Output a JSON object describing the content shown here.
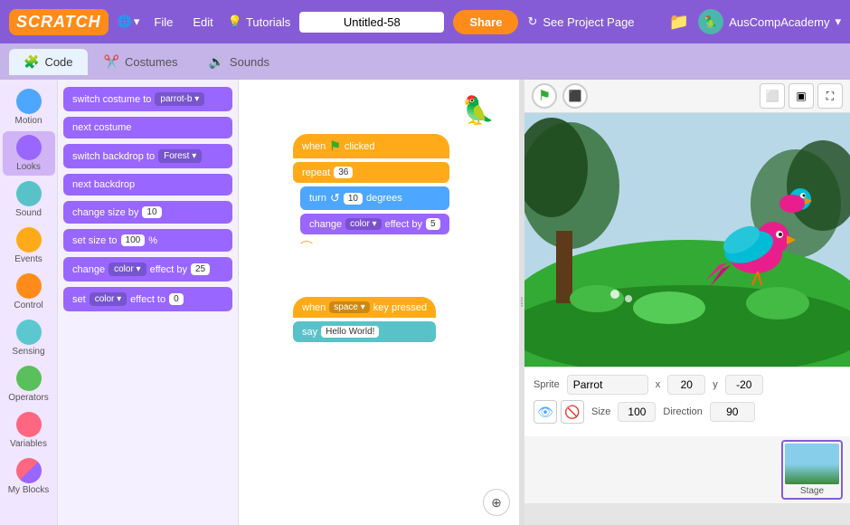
{
  "app": {
    "title": "Scratch",
    "logo": "SCRATCH"
  },
  "topnav": {
    "globe_label": "🌐",
    "file_label": "File",
    "edit_label": "Edit",
    "tutorials_label": "Tutorials",
    "tutorials_icon": "💡",
    "project_title": "Untitled-58",
    "share_label": "Share",
    "see_project_label": "See Project Page",
    "folder_icon": "📁",
    "user_name": "AusCompAcademy",
    "chevron": "▾"
  },
  "tabs": {
    "code_label": "Code",
    "costumes_label": "Costumes",
    "sounds_label": "Sounds"
  },
  "sidebar": {
    "items": [
      {
        "id": "motion",
        "label": "Motion",
        "color": "#4da6ff"
      },
      {
        "id": "looks",
        "label": "Looks",
        "color": "#9966ff"
      },
      {
        "id": "sound",
        "label": "Sound",
        "color": "#59c2c9"
      },
      {
        "id": "events",
        "label": "Events",
        "color": "#ffab19"
      },
      {
        "id": "control",
        "label": "Control",
        "color": "#ff8c1a"
      },
      {
        "id": "sensing",
        "label": "Sensing",
        "color": "#59c2c9"
      },
      {
        "id": "operators",
        "label": "Operators",
        "color": "#59c05b"
      },
      {
        "id": "variables",
        "label": "Variables",
        "color": "#ff6680"
      },
      {
        "id": "myblocks",
        "label": "My Blocks",
        "color": "#ff0066"
      }
    ]
  },
  "blocks_panel": {
    "blocks": [
      {
        "text": "switch costume to",
        "dropdown": "parrot-b",
        "color": "purple"
      },
      {
        "text": "next costume",
        "color": "purple"
      },
      {
        "text": "switch backdrop to",
        "dropdown": "Forest",
        "color": "purple"
      },
      {
        "text": "next backdrop",
        "color": "purple"
      },
      {
        "text": "change size by",
        "value": "10",
        "color": "purple"
      },
      {
        "text": "set size to",
        "value": "100",
        "suffix": "%",
        "color": "purple"
      },
      {
        "text": "change",
        "dropdown": "color",
        "suffix": "effect by",
        "value": "25",
        "color": "purple"
      },
      {
        "text": "set",
        "dropdown": "color",
        "suffix": "effect to",
        "value": "0",
        "color": "purple"
      }
    ]
  },
  "scripts": {
    "script1": {
      "blocks": [
        {
          "type": "hat",
          "text": "when",
          "flag": true,
          "suffix": "clicked"
        },
        {
          "type": "orange",
          "text": "repeat",
          "value": "36"
        },
        {
          "type": "blue",
          "text": "turn",
          "icon": "↺",
          "value": "10",
          "suffix": "degrees"
        },
        {
          "type": "purple",
          "text": "change",
          "dropdown": "color",
          "suffix": "effect by",
          "value": "5"
        }
      ]
    },
    "script2": {
      "blocks": [
        {
          "type": "hat2",
          "text": "when",
          "dropdown": "space",
          "suffix": "key pressed"
        },
        {
          "type": "teal",
          "text": "say",
          "value": "Hello World!"
        }
      ]
    }
  },
  "stage": {
    "green_flag_tooltip": "Green Flag",
    "stop_tooltip": "Stop",
    "sprite_label": "Sprite",
    "sprite_name": "Parrot",
    "x_label": "x",
    "x_value": "20",
    "y_label": "y",
    "y_value": "-20",
    "size_label": "Size",
    "size_value": "100",
    "direction_label": "Direction",
    "direction_value": "90",
    "stage_label": "Stage"
  },
  "zoom": {
    "icon": "⊕"
  }
}
